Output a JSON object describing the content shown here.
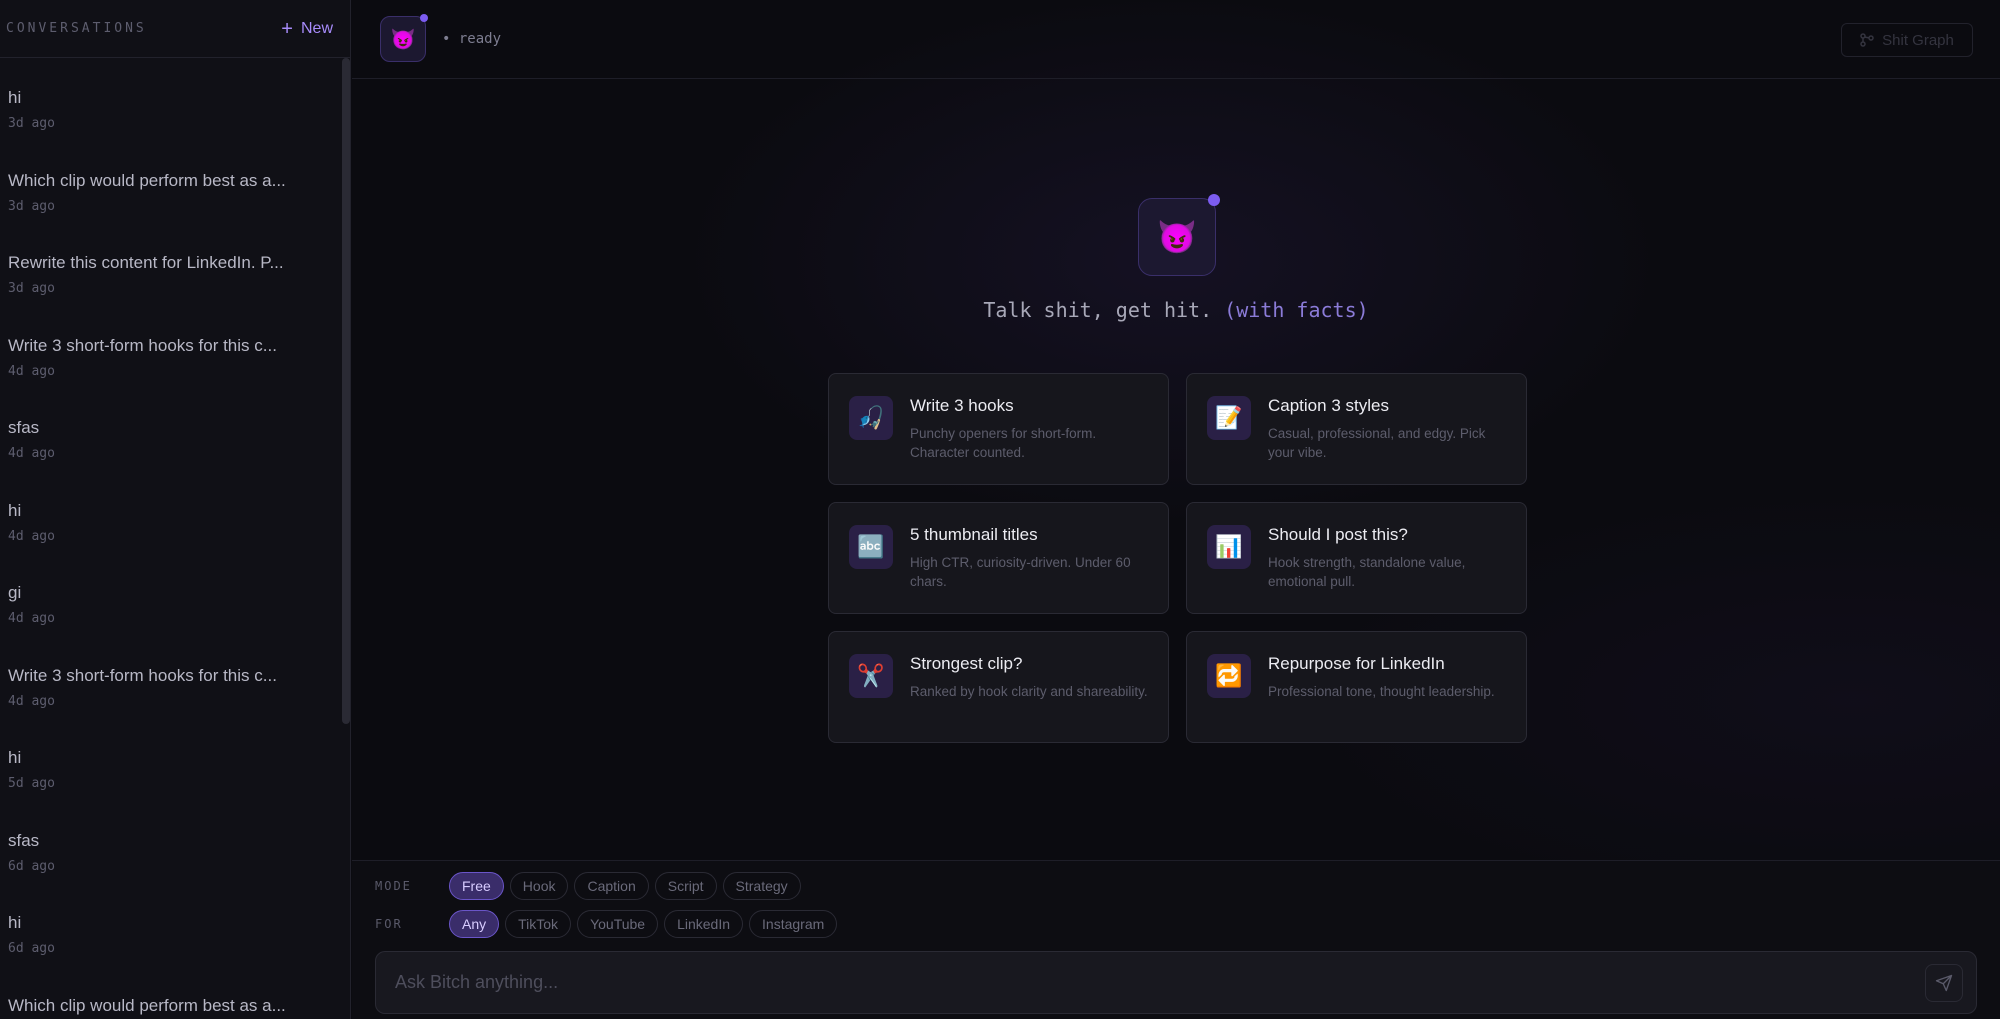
{
  "sidebar": {
    "title": "CONVERSATIONS",
    "new_label": "New",
    "conversations": [
      {
        "title": "hi",
        "time": "3d ago"
      },
      {
        "title": "Which clip would perform best as a...",
        "time": "3d ago"
      },
      {
        "title": "Rewrite this content for LinkedIn. P...",
        "time": "3d ago"
      },
      {
        "title": "Write 3 short-form hooks for this c...",
        "time": "4d ago"
      },
      {
        "title": "sfas",
        "time": "4d ago"
      },
      {
        "title": "hi",
        "time": "4d ago"
      },
      {
        "title": "gi",
        "time": "4d ago"
      },
      {
        "title": "Write 3 short-form hooks for this c...",
        "time": "4d ago"
      },
      {
        "title": "hi",
        "time": "5d ago"
      },
      {
        "title": "sfas",
        "time": "6d ago"
      },
      {
        "title": "hi",
        "time": "6d ago"
      },
      {
        "title": "Which clip would perform best as a...",
        "time": ""
      }
    ]
  },
  "topbar": {
    "avatar_icon": "😈",
    "status": "• ready",
    "graph_label": "Shit Graph"
  },
  "hero": {
    "icon": "😈",
    "tagline": "Talk shit, get hit.",
    "tagline_accent": "(with facts)"
  },
  "cards": [
    {
      "icon": "🎣",
      "title": "Write 3 hooks",
      "desc": "Punchy openers for short-form. Character counted."
    },
    {
      "icon": "📝",
      "title": "Caption 3 styles",
      "desc": "Casual, professional, and edgy. Pick your vibe."
    },
    {
      "icon": "🔤",
      "title": "5 thumbnail titles",
      "desc": "High CTR, curiosity-driven. Under 60 chars."
    },
    {
      "icon": "📊",
      "title": "Should I post this?",
      "desc": "Hook strength, standalone value, emotional pull."
    },
    {
      "icon": "✂️",
      "title": "Strongest clip?",
      "desc": "Ranked by hook clarity and shareability."
    },
    {
      "icon": "🔁",
      "title": "Repurpose for LinkedIn",
      "desc": "Professional tone, thought leadership."
    }
  ],
  "composer": {
    "mode_label": "MODE",
    "modes": [
      "Free",
      "Hook",
      "Caption",
      "Script",
      "Strategy"
    ],
    "active_mode": "Free",
    "for_label": "FOR",
    "platforms": [
      "Any",
      "TikTok",
      "YouTube",
      "LinkedIn",
      "Instagram"
    ],
    "active_platform": "Any",
    "placeholder": "Ask Bitch anything...",
    "value": ""
  },
  "colors": {
    "accent": "#7c5cf0",
    "accent_text": "#a78bfa",
    "background": "#0b0b10",
    "card_bg": "#16161c"
  }
}
